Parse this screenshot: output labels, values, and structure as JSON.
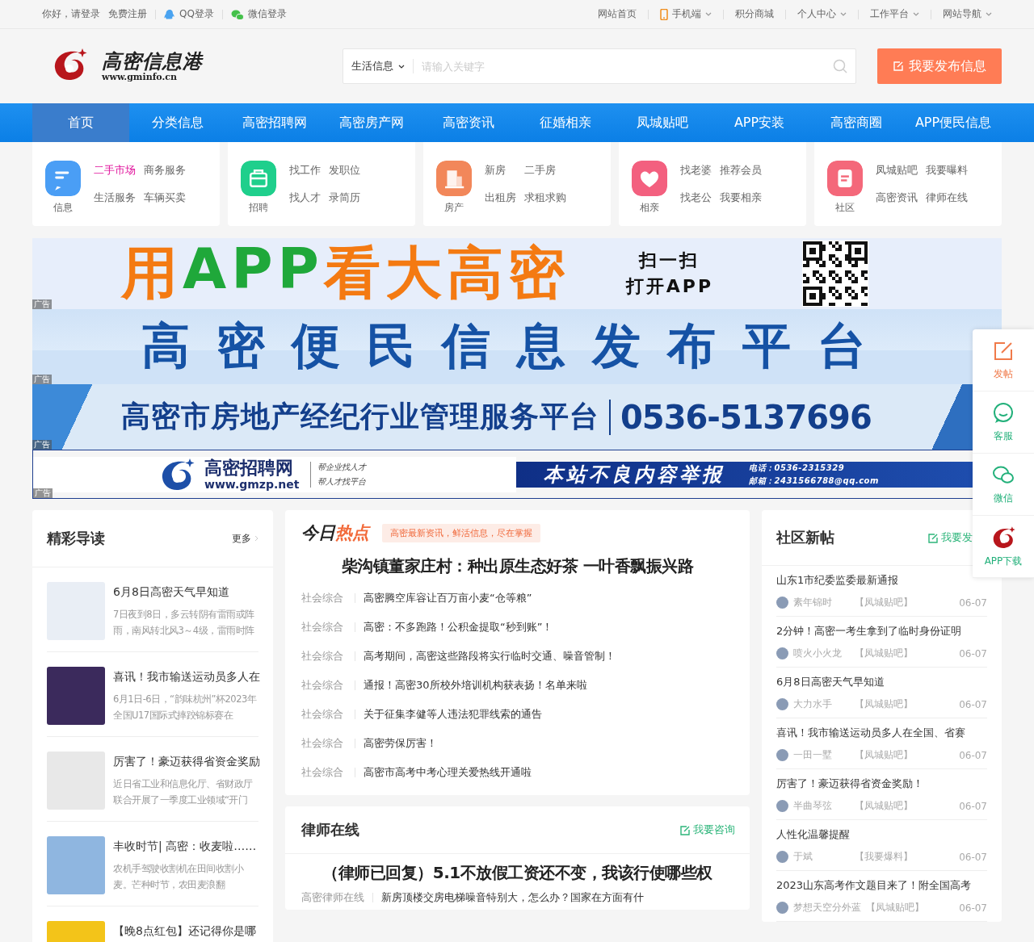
{
  "top_bar": {
    "greeting": "你好，",
    "login": "请登录",
    "register": "免费注册",
    "qq_login": "QQ登录",
    "wechat_login": "微信登录",
    "links": [
      {
        "label": "网站首页",
        "kind": "plain",
        "dropdown": false
      },
      {
        "label": "手机端",
        "kind": "phone",
        "dropdown": true
      },
      {
        "label": "积分商城",
        "kind": "plain",
        "dropdown": false
      },
      {
        "label": "个人中心",
        "kind": "plain",
        "dropdown": true
      },
      {
        "label": "工作平台",
        "kind": "plain",
        "dropdown": true
      },
      {
        "label": "网站导航",
        "kind": "plain",
        "dropdown": true
      }
    ]
  },
  "header": {
    "logo_name": "高密信息港",
    "logo_url": "www.gminfo.cn",
    "search_category": "生活信息",
    "search_placeholder": "请输入关键字",
    "publish_button": "我要发布信息"
  },
  "nav": [
    {
      "label": "首页",
      "selected": true
    },
    {
      "label": "分类信息",
      "selected": false
    },
    {
      "label": "高密招聘网",
      "selected": false
    },
    {
      "label": "高密房产网",
      "selected": false
    },
    {
      "label": "高密资讯",
      "selected": false
    },
    {
      "label": "征婚相亲",
      "selected": false
    },
    {
      "label": "凤城贴吧",
      "selected": false
    },
    {
      "label": "APP安装",
      "selected": false
    },
    {
      "label": "高密商圈",
      "selected": false
    },
    {
      "label": "APP便民信息",
      "selected": false
    }
  ],
  "categories": [
    {
      "label": "信息",
      "kind": "chat",
      "color": "#4a9ef5",
      "links": [
        {
          "label": "二手市场",
          "highlighted": true
        },
        {
          "label": "商务服务",
          "highlighted": false
        },
        {
          "label": "生活服务",
          "highlighted": false
        },
        {
          "label": "车辆买卖",
          "highlighted": false
        }
      ]
    },
    {
      "label": "招聘",
      "kind": "bag",
      "color": "#1fcf8c",
      "links": [
        {
          "label": "找工作",
          "highlighted": false
        },
        {
          "label": "发职位",
          "highlighted": false
        },
        {
          "label": "找人才",
          "highlighted": false
        },
        {
          "label": "录简历",
          "highlighted": false
        }
      ]
    },
    {
      "label": "房产",
      "kind": "building",
      "color": "#f2875a",
      "links": [
        {
          "label": "新房",
          "highlighted": false
        },
        {
          "label": "二手房",
          "highlighted": false
        },
        {
          "label": "出租房",
          "highlighted": false
        },
        {
          "label": "求租求购",
          "highlighted": false
        }
      ]
    },
    {
      "label": "相亲",
      "kind": "heart",
      "color": "#f3607f",
      "links": [
        {
          "label": "找老婆",
          "highlighted": false
        },
        {
          "label": "推荐会员",
          "highlighted": false
        },
        {
          "label": "找老公",
          "highlighted": false
        },
        {
          "label": "我要相亲",
          "highlighted": false
        }
      ]
    },
    {
      "label": "社区",
      "kind": "note",
      "color": "#f4687a",
      "links": [
        {
          "label": "凤城贴吧",
          "highlighted": false
        },
        {
          "label": "我要曝料",
          "highlighted": false
        },
        {
          "label": "高密资讯",
          "highlighted": false
        },
        {
          "label": "律师在线",
          "highlighted": false
        }
      ]
    }
  ],
  "banners": [
    {
      "kind": "app",
      "tag": "广告",
      "headline": [
        {
          "text": "用",
          "color": "#f47a12"
        },
        {
          "text": "APP",
          "color": "#1fa83a"
        },
        {
          "text": "看大高密",
          "color": "#f47a12"
        }
      ],
      "scan_lines": [
        "扫一扫",
        "打开APP"
      ]
    },
    {
      "kind": "platform",
      "tag": "广告",
      "title": "高密便民信息发布平台"
    },
    {
      "kind": "realestate",
      "tag": "广告",
      "title": "高密市房地产经纪行业管理服务平台",
      "phone": "0536-5137696"
    },
    {
      "kind": "report",
      "tag": "广告",
      "logo_name": "高密招聘网",
      "logo_url": "www.gmzp.net",
      "slogans": [
        "帮企业找人才",
        "帮人才找平台"
      ],
      "report_title": "本站不良内容举报",
      "contacts": [
        "电话：0536-2315329",
        "邮箱：2431566788@qq.com"
      ]
    }
  ],
  "featured": {
    "title": "精彩导读",
    "more": "更多",
    "articles": [
      {
        "title": "6月8日高密天气早知道",
        "summary": "7日夜到8日，多云转阴有雷雨或阵雨，南风转北风3～4级，雷雨时阵"
      },
      {
        "title": "喜讯！我市输送运动员多人在",
        "summary": "6月1日-6日，“韵味杭州”杯2023年全国U17国际式摔跤锦标赛在"
      },
      {
        "title": "厉害了！豪迈获得省资金奖励",
        "summary": "近日省工业和信息化厅、省财政厅联合开展了一季度工业领域“开门"
      },
      {
        "title": "丰收时节| 高密：收麦啦……",
        "summary": "农机手驾驶收割机在田间收割小麦。芒种时节，农田麦浪翻"
      },
      {
        "title": "【晚8点红包】还记得你是哪"
      }
    ]
  },
  "hot": {
    "title_parts": [
      "今日",
      "热点"
    ],
    "tagline": "高密最新资讯，鲜活信息，尽在掌握",
    "headline": "柴沟镇董家庄村：种出原生态好茶 一叶香飘振兴路",
    "items": [
      {
        "category": "社会综合",
        "title": "高密腾空库容让百万亩小麦“仓等粮”"
      },
      {
        "category": "社会综合",
        "title": "高密：不多跑路！公积金提取“秒到账”！"
      },
      {
        "category": "社会综合",
        "title": "高考期间，高密这些路段将实行临时交通、噪音管制！"
      },
      {
        "category": "社会综合",
        "title": "通报！高密30所校外培训机构获表扬！名单来啦"
      },
      {
        "category": "社会综合",
        "title": "关于征集李健等人违法犯罪线索的通告"
      },
      {
        "category": "社会综合",
        "title": "高密劳保厉害！"
      },
      {
        "category": "社会综合",
        "title": "高密市高考中考心理关爱热线开通啦"
      }
    ]
  },
  "lawyer": {
    "title": "律师在线",
    "action": "我要咨询",
    "headline": "（律师已回复）5.1不放假工资还不变，我该行使哪些权",
    "items": [
      {
        "category": "高密律师在线",
        "title": "新房顶楼交房电梯噪音特别大，怎么办？国家在方面有什"
      }
    ]
  },
  "community": {
    "title": "社区新帖",
    "action": "我要发",
    "posts": [
      {
        "title": "山东1市纪委监委最新通报",
        "user": "素年锦时",
        "forum": "【凤城贴吧】",
        "date": "06-07"
      },
      {
        "title": "2分钟！高密一考生拿到了临时身份证明",
        "user": "喷火小火龙",
        "forum": "【凤城贴吧】",
        "date": "06-07"
      },
      {
        "title": "6月8日高密天气早知道",
        "user": "大力水手",
        "forum": "【凤城贴吧】",
        "date": "06-07"
      },
      {
        "title": "喜讯！我市输送运动员多人在全国、省赛",
        "user": "一田一墅",
        "forum": "【凤城贴吧】",
        "date": "06-07"
      },
      {
        "title": "厉害了！豪迈获得省资金奖励！",
        "user": "半曲琴弦",
        "forum": "【凤城贴吧】",
        "date": "06-07"
      },
      {
        "title": "人性化温馨提醒",
        "user": "于斌",
        "forum": "【我要爆料】",
        "date": "06-07"
      },
      {
        "title": "2023山东高考作文题目来了！附全国高考",
        "user": "梦想天空分外蓝",
        "forum": "【凤城贴吧】",
        "date": "06-07"
      }
    ]
  },
  "float_bar": [
    {
      "label": "发帖",
      "kind": "post"
    },
    {
      "label": "客服",
      "kind": "service"
    },
    {
      "label": "微信",
      "kind": "wechat"
    },
    {
      "label": "APP下载",
      "kind": "app"
    }
  ]
}
